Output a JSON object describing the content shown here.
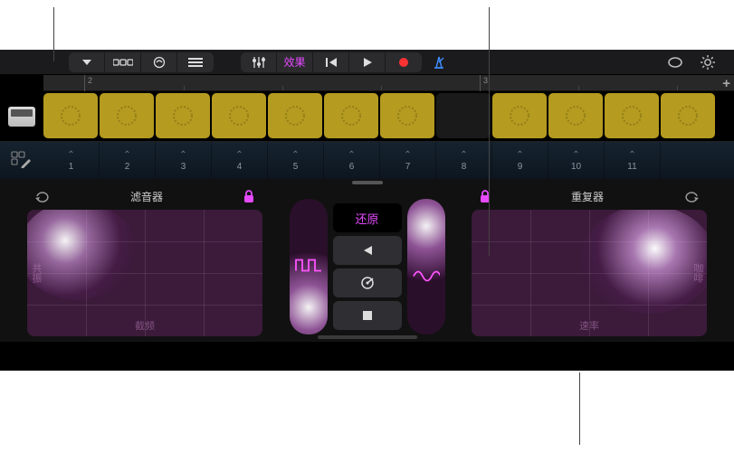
{
  "toolbar": {
    "fx_label": "效果"
  },
  "ruler": {
    "marks": [
      "2",
      "3"
    ],
    "add": "+"
  },
  "tabs": [
    "1",
    "2",
    "3",
    "4",
    "5",
    "6",
    "7",
    "8",
    "9",
    "10",
    "11"
  ],
  "fx_left": {
    "title": "滤音器",
    "xlabel": "截频",
    "ylabel": "共振"
  },
  "fx_right": {
    "title": "重复器",
    "xlabel": "速率",
    "ylabel": "咖啡"
  },
  "center": {
    "reset": "还原"
  },
  "icons": {
    "menu_down": "menu-down-icon",
    "view": "view-icon",
    "instrument": "instrument-icon",
    "list": "list-icon",
    "mixer": "mixer-icon",
    "rewind": "rewind-icon",
    "play": "play-icon",
    "record": "record-icon",
    "metronome": "metronome-icon",
    "loop": "loop-icon",
    "settings": "settings-icon",
    "cycle": "cycle-icon",
    "lock": "lock-icon",
    "reverse": "reverse-icon",
    "scratch": "scratch-icon",
    "stop": "stop-icon",
    "square_wave": "square-wave-icon",
    "sine_wave": "sine-wave-icon"
  },
  "colors": {
    "accent": "#e64aff",
    "clip": "#b59b1f",
    "record": "#ff3333",
    "metronome": "#3f8cff"
  }
}
